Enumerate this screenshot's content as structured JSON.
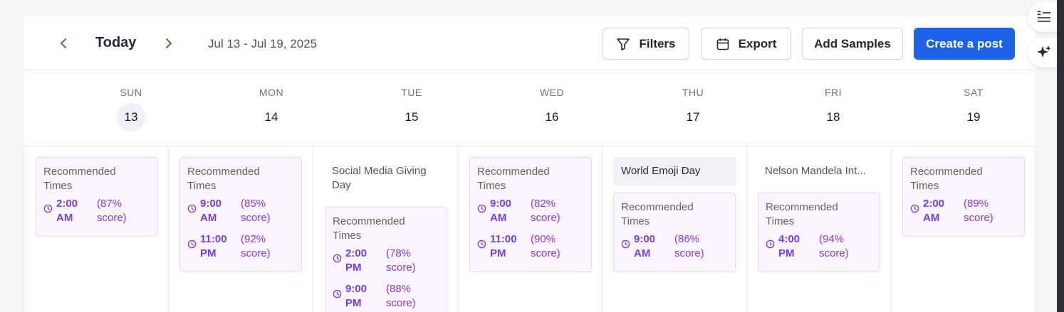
{
  "toolbar": {
    "prev_icon": "chevron-left-icon",
    "today_label": "Today",
    "next_icon": "chevron-right-icon",
    "date_range": "Jul 13 - Jul 19, 2025",
    "filters_label": "Filters",
    "export_label": "Export",
    "add_samples_label": "Add Samples",
    "create_post_label": "Create a post"
  },
  "days": [
    {
      "name": "SUN",
      "num": "13",
      "is_today": true
    },
    {
      "name": "MON",
      "num": "14"
    },
    {
      "name": "TUE",
      "num": "15"
    },
    {
      "name": "WED",
      "num": "16"
    },
    {
      "name": "THU",
      "num": "17"
    },
    {
      "name": "FRI",
      "num": "18"
    },
    {
      "name": "SAT",
      "num": "19"
    }
  ],
  "columns": [
    {
      "events": [],
      "recommended": {
        "title": "Recommended Times",
        "slots": [
          {
            "time": "2:00 AM",
            "score": "(87% score)"
          }
        ]
      }
    },
    {
      "events": [],
      "recommended": {
        "title": "Recommended Times",
        "slots": [
          {
            "time": "9:00 AM",
            "score": "(85% score)"
          },
          {
            "time": "11:00 PM",
            "score": "(92% score)"
          }
        ]
      }
    },
    {
      "events": [
        {
          "label": "Social Media Giving Day",
          "style": "plain"
        }
      ],
      "recommended": {
        "title": "Recommended Times",
        "slots": [
          {
            "time": "2:00 PM",
            "score": "(78% score)"
          },
          {
            "time": "9:00 PM",
            "score": "(88% score)"
          }
        ]
      }
    },
    {
      "events": [],
      "recommended": {
        "title": "Recommended Times",
        "slots": [
          {
            "time": "9:00 AM",
            "score": "(82% score)"
          },
          {
            "time": "11:00 PM",
            "score": "(90% score)"
          }
        ]
      }
    },
    {
      "events": [
        {
          "label": "World Emoji Day",
          "style": "chip"
        }
      ],
      "recommended": {
        "title": "Recommended Times",
        "slots": [
          {
            "time": "9:00 AM",
            "score": "(86% score)"
          }
        ]
      }
    },
    {
      "events": [
        {
          "label": "Nelson Mandela Int...",
          "style": "plain"
        }
      ],
      "recommended": {
        "title": "Recommended Times",
        "slots": [
          {
            "time": "4:00 PM",
            "score": "(94% score)"
          }
        ]
      }
    },
    {
      "events": [],
      "recommended": {
        "title": "Recommended Times",
        "slots": [
          {
            "time": "2:00 AM",
            "score": "(89% score)"
          }
        ]
      }
    }
  ],
  "side_buttons": [
    "notes-icon",
    "sparkle-icon"
  ],
  "colors": {
    "primary": "#1d63e8",
    "accent_purple": "#7c3aed",
    "card_bg": "#faf5ff"
  }
}
